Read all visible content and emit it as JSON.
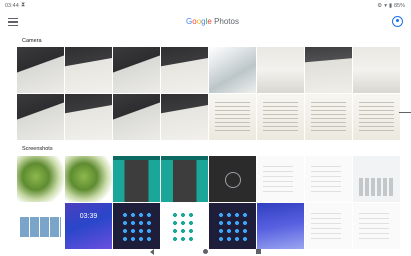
{
  "status_bar": {
    "time": "03:44",
    "battery": "85%"
  },
  "app_bar": {
    "logo_google": [
      "G",
      "o",
      "o",
      "g",
      "l",
      "e"
    ],
    "logo_photos": "Photos"
  },
  "sections": [
    {
      "title": "Camera",
      "tiles": [
        "cam-a",
        "cam-b",
        "cam-a",
        "cam-b",
        "cam-c",
        "cam-d",
        "cam-e",
        "cam-d",
        "cam-a",
        "cam-b",
        "cam-a",
        "cam-b",
        "cam-f",
        "cam-f",
        "cam-f",
        "cam-f"
      ]
    },
    {
      "title": "Screenshots",
      "tiles": [
        "ss-plant",
        "ss-plant",
        "ss-teal",
        "ss-teal",
        "ss-dark",
        "ss-white",
        "ss-white",
        "ss-keys",
        "ss-photos",
        "ss-lock",
        "ss-navy",
        "ss-settings",
        "ss-navy",
        "ss-home",
        "ss-white",
        "ss-white"
      ]
    }
  ],
  "lock_clock": "03:39"
}
